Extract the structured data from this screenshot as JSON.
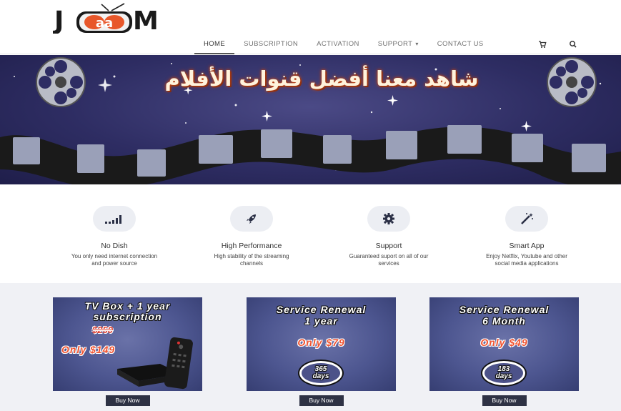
{
  "brand": {
    "logo_letters_left": "J",
    "logo_letters_mid": "aa",
    "logo_letters_right": "M"
  },
  "nav": {
    "items": [
      {
        "label": "HOME",
        "active": true
      },
      {
        "label": "SUBSCRIPTION"
      },
      {
        "label": "ACTIVATION"
      },
      {
        "label": "SUPPORT",
        "has_dropdown": true
      },
      {
        "label": "CONTACT US"
      }
    ],
    "cart_icon": "cart-icon",
    "search_icon": "search-icon",
    "dropdown_caret": "▾"
  },
  "banner": {
    "title": "شاهد معنا أفضل قنوات الأفلام"
  },
  "features": [
    {
      "icon": "signal-icon",
      "title": "No Dish",
      "desc_line1": "You only need internet connection",
      "desc_line2": "and power source"
    },
    {
      "icon": "rocket-icon",
      "title": "High Performance",
      "desc_line1": "High stability of the streaming",
      "desc_line2": "channels"
    },
    {
      "icon": "gear-icon",
      "title": "Support",
      "desc_line1": "Guaranteed suport on all of our",
      "desc_line2": "services"
    },
    {
      "icon": "magic-wand-icon",
      "title": "Smart App",
      "desc_line1": "Enjoy Netflix, Youtube and other",
      "desc_line2": "social media applications"
    }
  ],
  "products": [
    {
      "title_line1": "TV Box + 1 year",
      "title_line2": "subscription",
      "old_price": "$250",
      "price": "Only $149",
      "button": "Buy Now"
    },
    {
      "title_line1": "Service Renewal",
      "title_line2": "1 year",
      "price": "Only $79",
      "badge_line1": "365",
      "badge_line2": "days",
      "button": "Buy Now"
    },
    {
      "title_line1": "Service Renewal",
      "title_line2": "6 Month",
      "price": "Only $49",
      "badge_line1": "183",
      "badge_line2": "days",
      "button": "Buy Now"
    }
  ],
  "colors": {
    "accent_orange": "#f0522f",
    "banner_bg": "#2e2d63",
    "card_bg": "#4d5690",
    "button_bg": "#2e3244"
  }
}
